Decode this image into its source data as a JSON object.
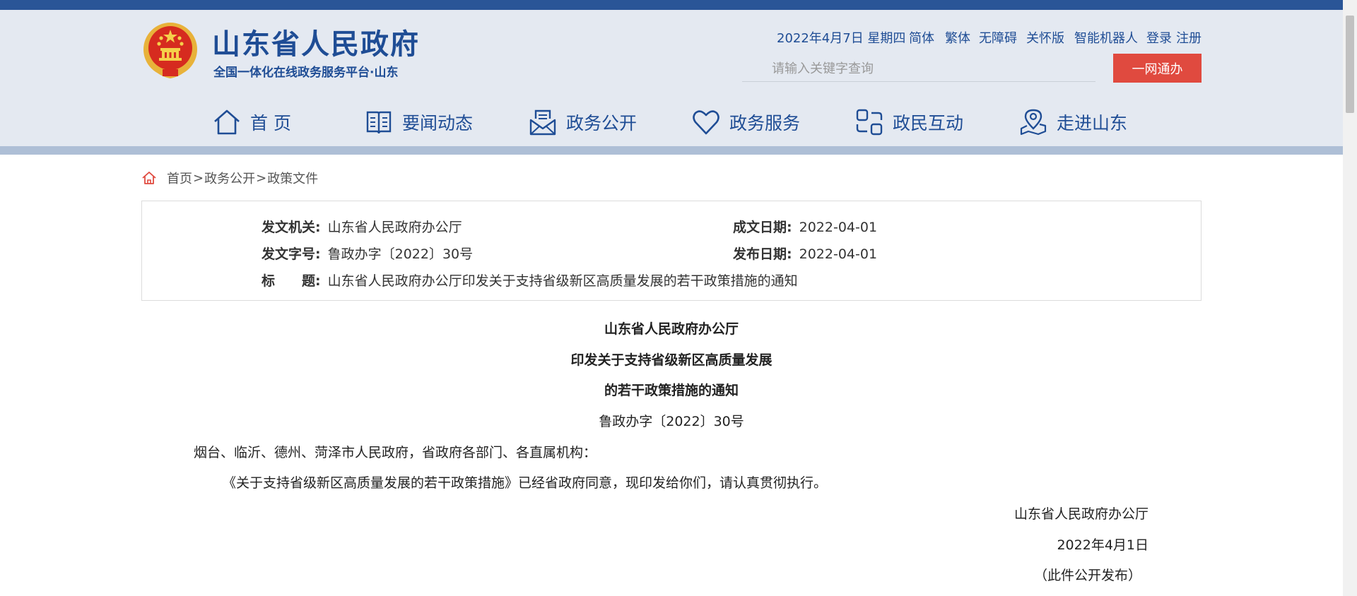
{
  "site": {
    "title": "山东省人民政府",
    "subtitle": "全国一体化在线政务服务平台·山东"
  },
  "top_links": {
    "date": "2022年4月7日 星期四",
    "simplified": "简体",
    "traditional": "繁体",
    "accessible": "无障碍",
    "elderly": "关怀版",
    "robot": "智能机器人",
    "login": "登录",
    "register": "注册"
  },
  "search": {
    "placeholder": "请输入关键字查询",
    "button_label": "一网通办"
  },
  "nav": {
    "home": "首 页",
    "news": "要闻动态",
    "public": "政务公开",
    "service": "政务服务",
    "interact": "政民互动",
    "about": "走进山东"
  },
  "breadcrumb": {
    "home": "首页",
    "sep1": ">",
    "public": "政务公开",
    "sep2": ">",
    "policy": "政策文件"
  },
  "info": {
    "issuer_label": "发文机关:",
    "issuer_value": "山东省人民政府办公厅",
    "date_written_label": "成文日期:",
    "date_written_value": "2022-04-01",
    "doc_no_label": "发文字号:",
    "doc_no_value": "鲁政办字〔2022〕30号",
    "publish_date_label": "发布日期:",
    "publish_date_value": "2022-04-01",
    "title_label": "标　　题:",
    "title_value": "山东省人民政府办公厅印发关于支持省级新区高质量发展的若干政策措施的通知"
  },
  "document": {
    "title_line1": "山东省人民政府办公厅",
    "title_line2": "印发关于支持省级新区高质量发展",
    "title_line3": "的若干政策措施的通知",
    "doc_number": "鲁政办字〔2022〕30号",
    "addressee": "烟台、临沂、德州、菏泽市人民政府，省政府各部门、各直属机构：",
    "body": "《关于支持省级新区高质量发展的若干政策措施》已经省政府同意，现印发给你们，请认真贯彻执行。",
    "signature": "山东省人民政府办公厅",
    "sign_date": "2022年4月1日",
    "note": "（此件公开发布）"
  },
  "colors": {
    "brand_blue": "#1f4d95",
    "topbar": "#2a5597",
    "header_bg": "#e4e9f1",
    "button_red": "#e04a3f"
  }
}
